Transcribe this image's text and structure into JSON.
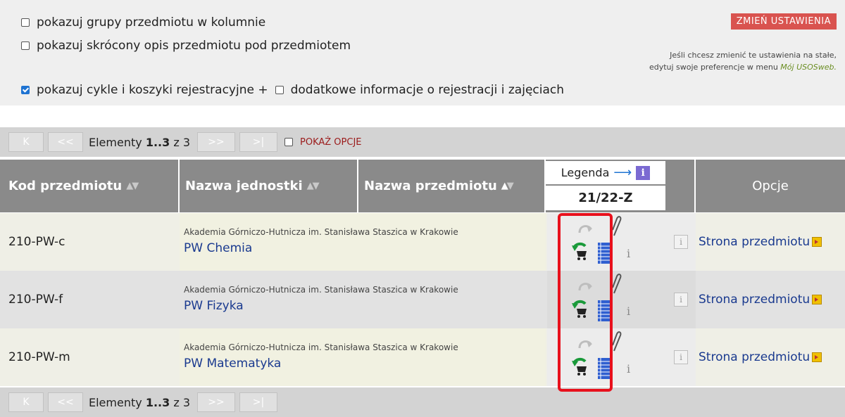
{
  "settings": {
    "opt_groups": "pokazuj grupy przedmiotu w kolumnie",
    "opt_short_desc": "pokazuj skrócony opis przedmiotu pod przedmiotem",
    "opt_cycles": "pokazuj cykle i koszyki rejestracyjne +",
    "opt_extra": "dodatkowe informacje o rejestracji i zajęciach",
    "change_button": "ZMIEŃ USTAWIENIA",
    "hint_line1": "Jeśli chcesz zmienić te ustawienia na stałe,",
    "hint_line2": "edytuj swoje preferencje w menu",
    "hint_link": "Mój USOSweb."
  },
  "pager": {
    "first": "K",
    "prev": "<<",
    "label": "Elementy",
    "range": "1..3",
    "of": "z 3",
    "next": ">>",
    "last": ">|",
    "show_options": "POKAŻ OPCJE"
  },
  "table": {
    "headers": {
      "code": "Kod przedmiotu",
      "unit": "Nazwa jednostki",
      "name": "Nazwa przedmiotu",
      "legend": "Legenda",
      "legend_info": "i",
      "term": "21/22-Z",
      "options": "Opcje"
    },
    "rows": [
      {
        "code": "210-PW-c",
        "unit": "Akademia Górniczo-Hutnicza im. Stanisława Staszica w Krakowie",
        "name": "PW Chemia",
        "info": "i",
        "link": "Strona przedmiotu"
      },
      {
        "code": "210-PW-f",
        "unit": "Akademia Górniczo-Hutnicza im. Stanisława Staszica w Krakowie",
        "name": "PW Fizyka",
        "info": "i",
        "link": "Strona przedmiotu"
      },
      {
        "code": "210-PW-m",
        "unit": "Akademia Górniczo-Hutnicza im. Stanisława Staszica w Krakowie",
        "name": "PW Matematyka",
        "info": "i",
        "link": "Strona przedmiotu"
      }
    ]
  },
  "colors": {
    "header_bg": "#8a8a8a",
    "row_odd": "#efefe6",
    "row_even": "#e2e2e2",
    "highlight": "#e8101c",
    "button_red": "#d9534f"
  }
}
